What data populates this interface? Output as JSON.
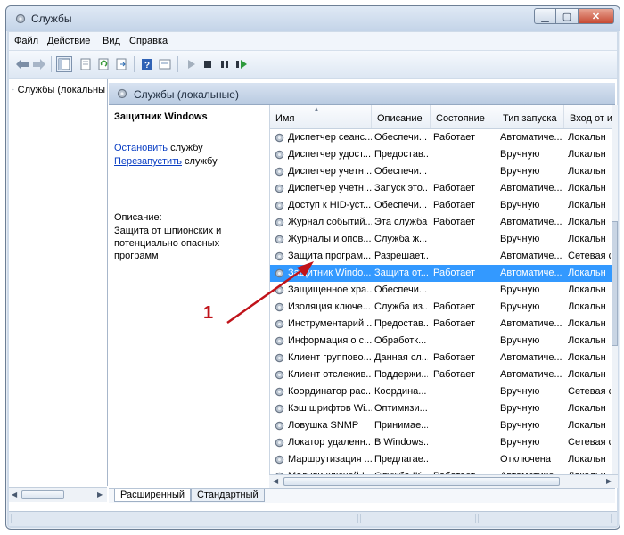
{
  "window": {
    "title": "Службы"
  },
  "menu": {
    "items": [
      "Файл",
      "Действие",
      "Вид",
      "Справка"
    ]
  },
  "tree": {
    "root_label": "Службы (локальны"
  },
  "main_header": {
    "title": "Службы (локальные)"
  },
  "details": {
    "service_name": "Защитник Windows",
    "stop_link": "Остановить",
    "stop_suffix": " службу",
    "restart_link": "Перезапустить",
    "restart_suffix": " службу",
    "description_label": "Описание:",
    "description_text": "Защита от шпионских  и потенциально опасных программ"
  },
  "table": {
    "columns": [
      "Имя",
      "Описание",
      "Состояние",
      "Тип запуска",
      "Вход от и"
    ],
    "rows": [
      {
        "name": "Диспетчер сеанс...",
        "desc": "Обеспечи...",
        "state": "Работает",
        "start": "Автоматиче...",
        "logon": "Локальн"
      },
      {
        "name": "Диспетчер удост...",
        "desc": "Предостав...",
        "state": "",
        "start": "Вручную",
        "logon": "Локальн"
      },
      {
        "name": "Диспетчер учетн...",
        "desc": "Обеспечи...",
        "state": "",
        "start": "Вручную",
        "logon": "Локальн"
      },
      {
        "name": "Диспетчер учетн...",
        "desc": "Запуск это...",
        "state": "Работает",
        "start": "Автоматиче...",
        "logon": "Локальн"
      },
      {
        "name": "Доступ к HID-уст...",
        "desc": "Обеспечи...",
        "state": "Работает",
        "start": "Вручную",
        "logon": "Локальн"
      },
      {
        "name": "Журнал событий...",
        "desc": "Эта служба...",
        "state": "Работает",
        "start": "Автоматиче...",
        "logon": "Локальн"
      },
      {
        "name": "Журналы и опов...",
        "desc": "Служба ж...",
        "state": "",
        "start": "Вручную",
        "logon": "Локальн"
      },
      {
        "name": "Защита програм...",
        "desc": "Разрешает...",
        "state": "",
        "start": "Автоматиче...",
        "logon": "Сетевая с"
      },
      {
        "name": "Защитник Windo...",
        "desc": "Защита от...",
        "state": "Работает",
        "start": "Автоматиче...",
        "logon": "Локальн",
        "selected": true
      },
      {
        "name": "Защищенное хра...",
        "desc": "Обеспечи...",
        "state": "",
        "start": "Вручную",
        "logon": "Локальн"
      },
      {
        "name": "Изоляция ключе...",
        "desc": "Служба из...",
        "state": "Работает",
        "start": "Вручную",
        "logon": "Локальн"
      },
      {
        "name": "Инструментарий ...",
        "desc": "Предостав...",
        "state": "Работает",
        "start": "Автоматиче...",
        "logon": "Локальн"
      },
      {
        "name": "Информация о с...",
        "desc": "Обработк...",
        "state": "",
        "start": "Вручную",
        "logon": "Локальн"
      },
      {
        "name": "Клиент группово...",
        "desc": "Данная сл...",
        "state": "Работает",
        "start": "Автоматиче...",
        "logon": "Локальн"
      },
      {
        "name": "Клиент отслежив...",
        "desc": "Поддержи...",
        "state": "Работает",
        "start": "Автоматиче...",
        "logon": "Локальн"
      },
      {
        "name": "Координатор рас...",
        "desc": "Координа...",
        "state": "",
        "start": "Вручную",
        "logon": "Сетевая с"
      },
      {
        "name": "Кэш шрифтов Wi...",
        "desc": "Оптимизи...",
        "state": "",
        "start": "Вручную",
        "logon": "Локальн"
      },
      {
        "name": "Ловушка SNMP",
        "desc": "Принимае...",
        "state": "",
        "start": "Вручную",
        "logon": "Локальн"
      },
      {
        "name": "Локатор удаленн...",
        "desc": "В Windows...",
        "state": "",
        "start": "Вручную",
        "logon": "Сетевая с"
      },
      {
        "name": "Маршрутизация ...",
        "desc": "Предлагае...",
        "state": "",
        "start": "Отключена",
        "logon": "Локальн"
      },
      {
        "name": "Модули ключей I...",
        "desc": "Служба IK...",
        "state": "Работает",
        "start": "Автоматиче...",
        "logon": "Локальн"
      }
    ]
  },
  "tabs": [
    "Расширенный",
    "Стандартный"
  ],
  "annotation": {
    "number": "1",
    "color": "#c0131a"
  },
  "colors": {
    "selection": "#3399ff",
    "link": "#0b3fc4"
  }
}
